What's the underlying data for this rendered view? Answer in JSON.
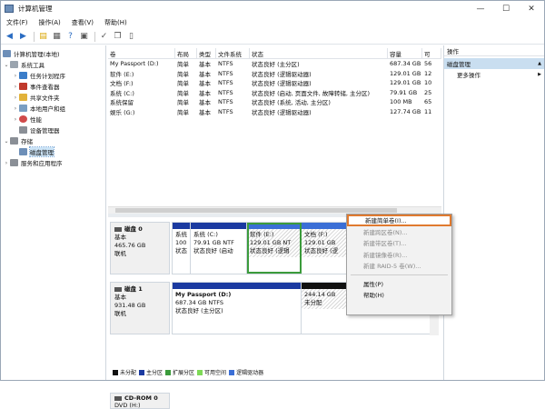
{
  "window": {
    "title": "计算机管理",
    "min": "—",
    "max": "☐",
    "close": "✕"
  },
  "menu": [
    "文件(F)",
    "操作(A)",
    "查看(V)",
    "帮助(H)"
  ],
  "tree": {
    "root": "计算机管理(本地)",
    "system_tools": "系统工具",
    "task_scheduler": "任务计划程序",
    "event_viewer": "事件查看器",
    "shared_folders": "共享文件夹",
    "local_users": "本地用户和组",
    "performance": "性能",
    "device_manager": "设备管理器",
    "storage": "存储",
    "disk_management": "磁盘管理",
    "services_apps": "服务和应用程序"
  },
  "table": {
    "headers": [
      "卷",
      "布局",
      "类型",
      "文件系统",
      "状态",
      "容量",
      "可"
    ],
    "rows": [
      [
        "My Passport (D:)",
        "简单",
        "基本",
        "NTFS",
        "状态良好 (主分区)",
        "687.34 GB",
        "56"
      ],
      [
        "软件 (E:)",
        "简单",
        "基本",
        "NTFS",
        "状态良好 (逻辑驱动器)",
        "129.01 GB",
        "12"
      ],
      [
        "文档 (F:)",
        "简单",
        "基本",
        "NTFS",
        "状态良好 (逻辑驱动器)",
        "129.01 GB",
        "10"
      ],
      [
        "系统 (C:)",
        "简单",
        "基本",
        "NTFS",
        "状态良好 (启动, 页面文件, 故障转储, 主分区)",
        "79.91 GB",
        "25"
      ],
      [
        "系统保留",
        "简单",
        "基本",
        "NTFS",
        "状态良好 (系统, 活动, 主分区)",
        "100 MB",
        "65"
      ],
      [
        "娱乐 (G:)",
        "简单",
        "基本",
        "NTFS",
        "状态良好 (逻辑驱动器)",
        "127.74 GB",
        "11"
      ]
    ]
  },
  "disks": {
    "disk0": {
      "name": "磁盘 0",
      "type": "基本",
      "size": "465.76 GB",
      "state": "联机",
      "parts": [
        {
          "l1": "系统",
          "l2": "100",
          "l3": "状态"
        },
        {
          "l1": "系统 (C:)",
          "l2": "79.91 GB NTF",
          "l3": "状态良好 (启动"
        },
        {
          "l1": "软件 (E:)",
          "l2": "129.01 GB NT",
          "l3": "状态良好 (逻辑"
        },
        {
          "l1": "文档 (F:)",
          "l2": "129.01 GB",
          "l3": "状态良好 (逻"
        }
      ]
    },
    "disk1": {
      "name": "磁盘 1",
      "type": "基本",
      "size": "931.48 GB",
      "state": "联机",
      "parts": [
        {
          "l1": "My Passport (D:)",
          "l2": "687.34 GB NTFS",
          "l3": "状态良好 (主分区)"
        },
        {
          "l1": "",
          "l2": "244.14 GB",
          "l3": "未分配"
        }
      ]
    },
    "cdrom": {
      "name": "CD-ROM 0",
      "type": "DVD (H:)"
    }
  },
  "legend": [
    {
      "label": "未分配",
      "color": "#111111"
    },
    {
      "label": "主分区",
      "color": "#1b3aa0"
    },
    {
      "label": "扩展分区",
      "color": "#3b9b3b"
    },
    {
      "label": "可用空间",
      "color": "#7ed957"
    },
    {
      "label": "逻辑驱动器",
      "color": "#3b6fd6"
    }
  ],
  "context_menu": {
    "items": [
      "新建简单卷(I)...",
      "新建跨区卷(N)...",
      "新建带区卷(T)...",
      "新建镜像卷(R)...",
      "新建 RAID-5 卷(W)..."
    ],
    "props": "属性(P)",
    "help": "帮助(H)"
  },
  "actions": {
    "header": "操作",
    "section": "磁盘管理",
    "more": "更多操作",
    "arrow_up": "▲",
    "arrow_right": "▶"
  }
}
